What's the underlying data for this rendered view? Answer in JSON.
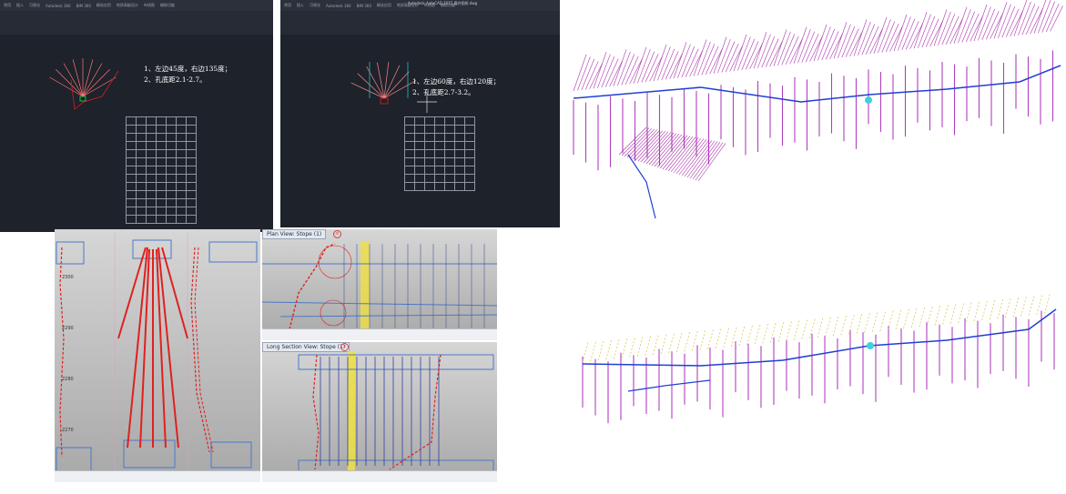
{
  "panel_a": {
    "ribbon": [
      "常用",
      "插入",
      "可视化",
      "Autodesk 360",
      "BIM 360",
      "精选应用",
      "地质高级设计",
      "布线图",
      "辅助功能"
    ],
    "note_line1": "1、左边45度，右边135度；",
    "note_line2": "2、孔底距2.1-2.7。"
  },
  "panel_b": {
    "title": "Autodesk AutoCAD 2015   露井图纸.dwg",
    "ribbon": [
      "常用",
      "插入",
      "可视化",
      "Autodesk 360",
      "BIM 360",
      "精选应用",
      "地质高级设计",
      "布线图",
      "辅助功能"
    ],
    "note_line1": "1、左边60度，右边120度；",
    "note_line2": "2、孔底距2.7-3.2。"
  },
  "panel_c": {
    "level_labels": [
      "2300",
      "2290",
      "2280",
      "2270"
    ]
  },
  "panel_d": {
    "tab_label": "Plan View: Stope (1)"
  },
  "panel_e": {
    "tab_label": "Long Section View: Stope (1)"
  },
  "colors": {
    "cad_bg": "#1e222b",
    "hole_red": "#e02020",
    "block_blue": "#4a78c8",
    "highlight_yellow": "#f0e040",
    "stope_magenta": "#a020a0",
    "drift_blue": "#2040d0"
  }
}
